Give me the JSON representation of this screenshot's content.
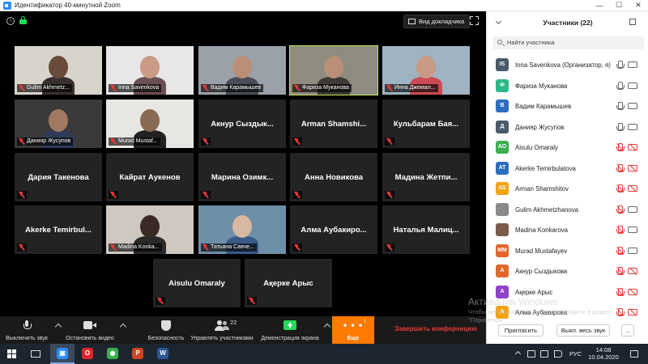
{
  "window": {
    "title": "Идентификатор 40-минутной Zoom",
    "controls": [
      "—",
      "☐",
      "✕"
    ]
  },
  "meeting": {
    "speaker_view_label": "Вид докладчика",
    "tiles": [
      {
        "name": "Gulim Akhmetz...",
        "video": true
      },
      {
        "name": "Inna Savenkova",
        "video": true
      },
      {
        "name": "Вадим Карамышев",
        "video": true
      },
      {
        "name": "Фариза Муканова",
        "video": true,
        "active": true
      },
      {
        "name": "Инна Джемал...",
        "video": true
      },
      {
        "name": "Данияр Жусупов",
        "video": true
      },
      {
        "name": "Murad Mustaf...",
        "video": true
      },
      {
        "name": "Акнур Сыздык...",
        "video": false
      },
      {
        "name": "Arman Shamshi...",
        "video": false
      },
      {
        "name": "Кульбарам Бая...",
        "video": false
      },
      {
        "name": "Дария Такенова",
        "video": false
      },
      {
        "name": "Кайрат Аукенов",
        "video": false
      },
      {
        "name": "Марина Озимк...",
        "video": false
      },
      {
        "name": "Анна Новикова",
        "video": false
      },
      {
        "name": "Мадина Жетпи...",
        "video": false
      },
      {
        "name": "Akerke Temirbul...",
        "video": false
      },
      {
        "name": "Madina Konka...",
        "video": true
      },
      {
        "name": "Татьяна Савче...",
        "video": true
      },
      {
        "name": "Алма Аубакиро...",
        "video": false
      },
      {
        "name": "Наталья Малиц...",
        "video": false
      },
      {
        "name": "Aisulu Omaraly",
        "video": false
      },
      {
        "name": "Ақерке Арыс",
        "video": false
      }
    ]
  },
  "toolbar": {
    "mute_label": "Выключить звук",
    "video_label": "Остановить видео",
    "security_label": "Безопасность",
    "participants_label": "Управлять участниками",
    "participants_count": "22",
    "share_label": "Демонстрация экрана",
    "more_label": "Еще",
    "more_badge": "1",
    "more_dots": "• • •",
    "end_label": "Завершить конференцию"
  },
  "panel": {
    "title": "Участники (22)",
    "search_placeholder": "Найти участника",
    "participants": [
      {
        "initials": "IS",
        "color": "#4a5a6a",
        "name": "Inna Savenkova (Организатор, я)",
        "mic": "on",
        "cam": "on"
      },
      {
        "initials": "Ф",
        "color": "#2eb886",
        "name": "Фариза Муканова",
        "mic": "on",
        "cam": "on"
      },
      {
        "initials": "В",
        "color": "#2d6dbf",
        "name": "Вадим Карамышев",
        "mic": "on",
        "cam": "on"
      },
      {
        "initials": "Д",
        "color": "#4a5a6a",
        "name": "Данияр Жусупов",
        "mic": "on",
        "cam": "on"
      },
      {
        "initials": "AO",
        "color": "#3cae4f",
        "name": "Aisulu Omaraly",
        "mic": "muted",
        "cam": "off"
      },
      {
        "initials": "AT",
        "color": "#2d6dbf",
        "name": "Akerke Temirbulatova",
        "mic": "muted",
        "cam": "off"
      },
      {
        "initials": "AS",
        "color": "#f2a316",
        "name": "Arman Shamshitov",
        "mic": "muted",
        "cam": "off"
      },
      {
        "initials": "",
        "color": "#8a8a8a",
        "name": "Gulim Akhmetzhanova",
        "mic": "muted",
        "cam": "on"
      },
      {
        "initials": "",
        "color": "#7a5a4a",
        "name": "Madina Konkarova",
        "mic": "muted",
        "cam": "on"
      },
      {
        "initials": "MM",
        "color": "#e0662b",
        "name": "Murad Mustafayev",
        "mic": "muted",
        "cam": "on"
      },
      {
        "initials": "А",
        "color": "#e0662b",
        "name": "Акнур Сыздыкова",
        "mic": "muted",
        "cam": "off"
      },
      {
        "initials": "А",
        "color": "#8e44c9",
        "name": "Ақерке Арыс",
        "mic": "muted",
        "cam": "off"
      },
      {
        "initials": "А",
        "color": "#f2a316",
        "name": "Алма Аубакирова",
        "mic": "muted",
        "cam": "off"
      }
    ],
    "invite_label": "Пригласить",
    "mute_all_label": "Выкл. весь звук",
    "more_label": "..."
  },
  "watermark": {
    "line1": "Активация Windows",
    "line2": "Чтобы активировать Windows, перейдите в раздел \"Параметры\"."
  },
  "taskbar": {
    "apps": [
      {
        "glyph": "▣",
        "color": "#2d8cff",
        "active": true
      },
      {
        "glyph": "O",
        "color": "#e0262b",
        "active": false
      },
      {
        "glyph": "◉",
        "color": "#3cae4f",
        "active": false
      },
      {
        "glyph": "P",
        "color": "#d04423",
        "active": false
      },
      {
        "glyph": "W",
        "color": "#2b5797",
        "active": false
      }
    ],
    "language": "РУС",
    "time": "14:08",
    "date": "10.04.2020"
  }
}
